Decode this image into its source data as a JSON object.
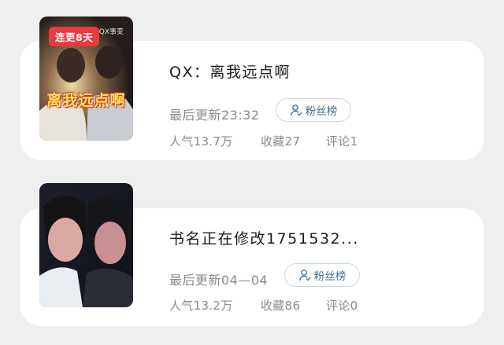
{
  "books": [
    {
      "title": "QX：离我远点啊",
      "cover_badge": "连更8天",
      "cover_tag": "QX事变",
      "cover_text": "离我远点啊",
      "update": "最后更新23:32",
      "fans_label": "粉丝榜",
      "popularity": "人气13.7万",
      "collections": "收藏27",
      "comments": "评论1"
    },
    {
      "title": "书名正在修改1751532...",
      "update": "最后更新04—04",
      "fans_label": "粉丝榜",
      "popularity": "人气13.2万",
      "collections": "收藏86",
      "comments": "评论0"
    }
  ],
  "colors": {
    "background": "#efefef",
    "card": "#ffffff",
    "badge": "#e83a3f",
    "fans_button_text": "#3e6f9e",
    "secondary_text": "#8a8a8a"
  },
  "icons": {
    "fans_button": "person-icon"
  }
}
